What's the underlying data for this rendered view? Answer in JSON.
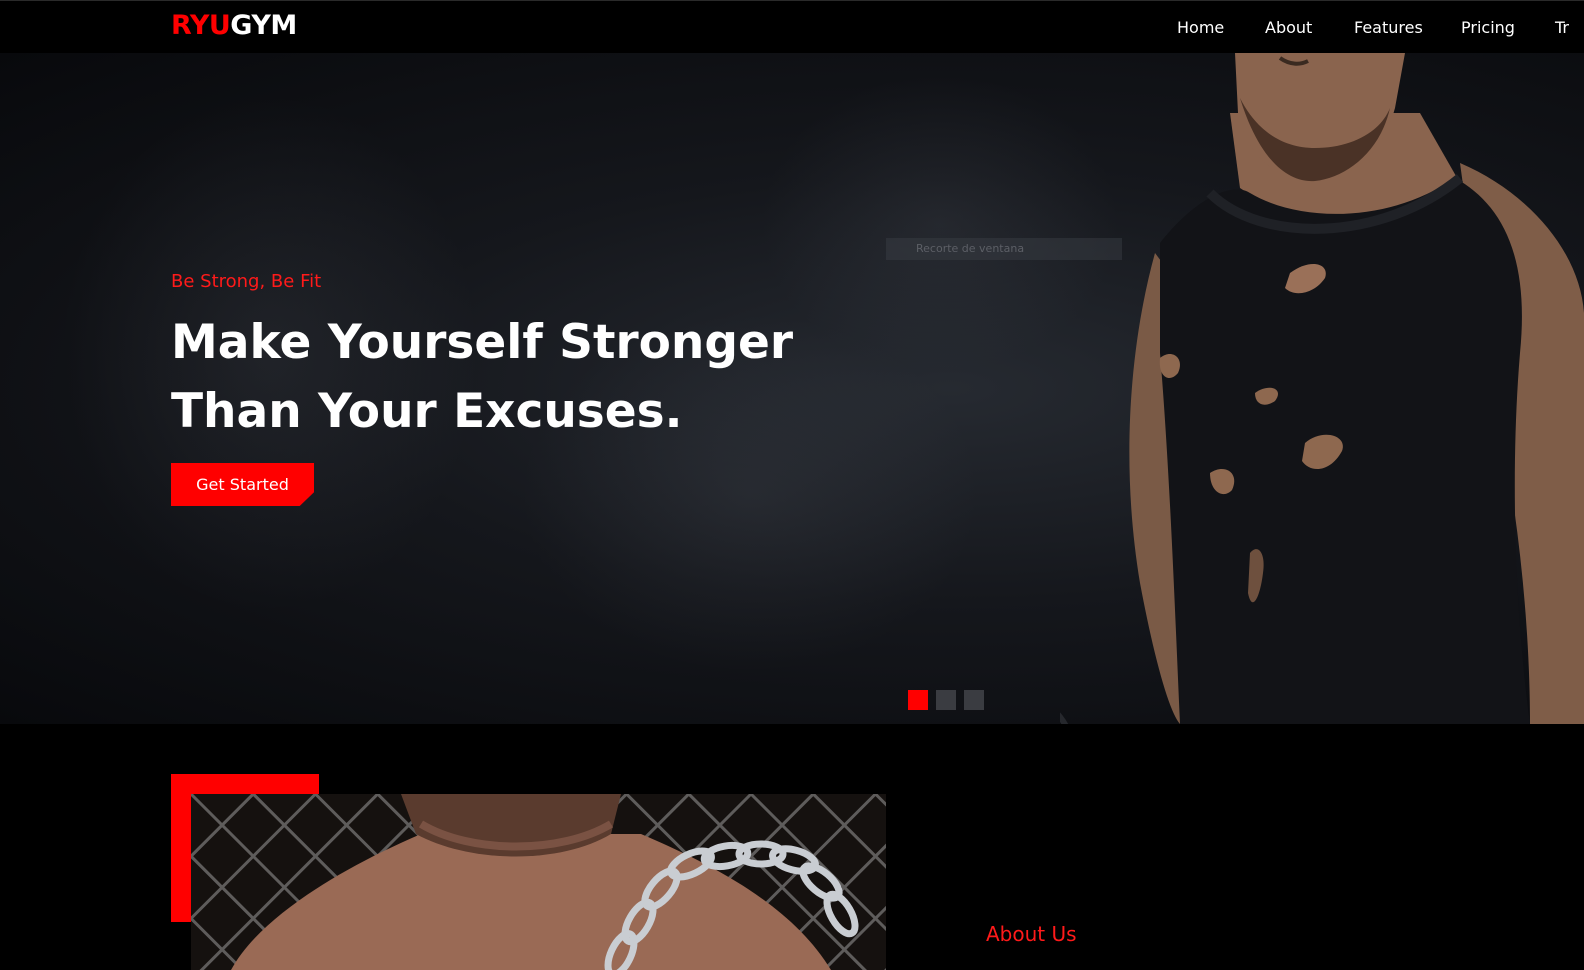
{
  "brand": {
    "part1": "RYU",
    "part2": "GYM",
    "accent": "#ff0000"
  },
  "nav": {
    "items": [
      {
        "label": "Home"
      },
      {
        "label": "About"
      },
      {
        "label": "Features"
      },
      {
        "label": "Pricing"
      },
      {
        "label": "Tr"
      }
    ]
  },
  "hero": {
    "tagline": "Be Strong, Be Fit",
    "headline_line1": "Make Yourself Stronger",
    "headline_line2": "Than Your Excuses.",
    "cta_label": "Get Started",
    "window_clip_label": "Recorte de ventana",
    "slides": {
      "count": 3,
      "active": 1
    }
  },
  "about": {
    "label": "About Us"
  }
}
